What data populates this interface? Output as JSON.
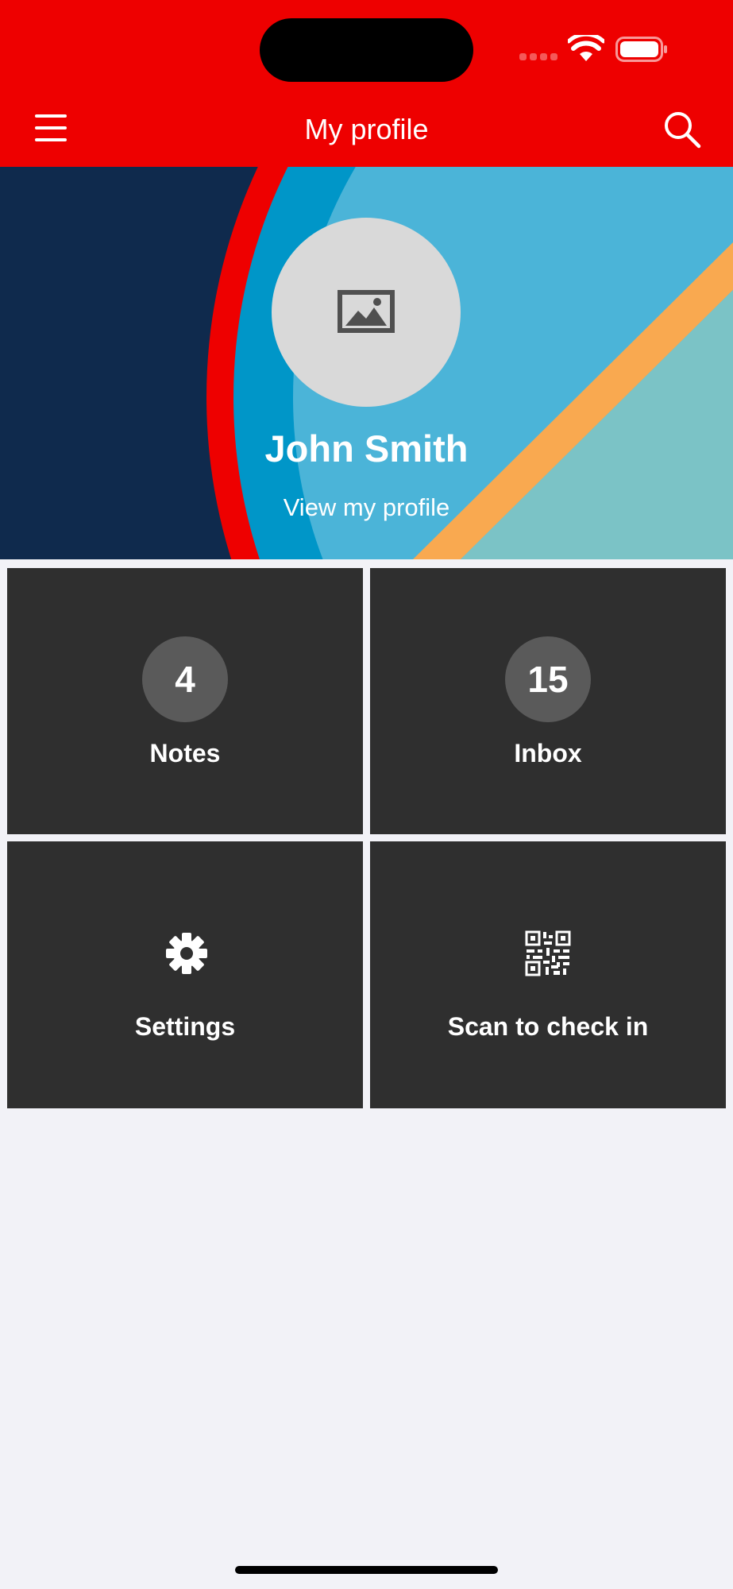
{
  "header": {
    "title": "My profile",
    "menu_icon": "hamburger-menu-icon",
    "search_icon": "search-icon",
    "background_color": "#ee0000"
  },
  "status_bar": {
    "wifi_icon": "wifi-icon",
    "battery_icon": "battery-icon"
  },
  "profile": {
    "name": "John Smith",
    "view_link": "View my profile",
    "avatar_icon": "image-placeholder-icon"
  },
  "tiles": [
    {
      "label": "Notes",
      "badge": "4"
    },
    {
      "label": "Inbox",
      "badge": "15"
    },
    {
      "label": "Settings",
      "icon": "gear-icon"
    },
    {
      "label": "Scan to check in",
      "icon": "qr-code-icon"
    }
  ],
  "colors": {
    "accent": "#ee0000",
    "tile_bg": "#2f2f2f",
    "badge_bg": "#5a5a5a",
    "page_bg": "#f2f2f7",
    "banner_navy": "#0f2a4d",
    "banner_blue": "#0096c8",
    "banner_light_blue": "#4bb4d8",
    "banner_orange": "#f9a950",
    "banner_teal": "#7bc3c6"
  }
}
